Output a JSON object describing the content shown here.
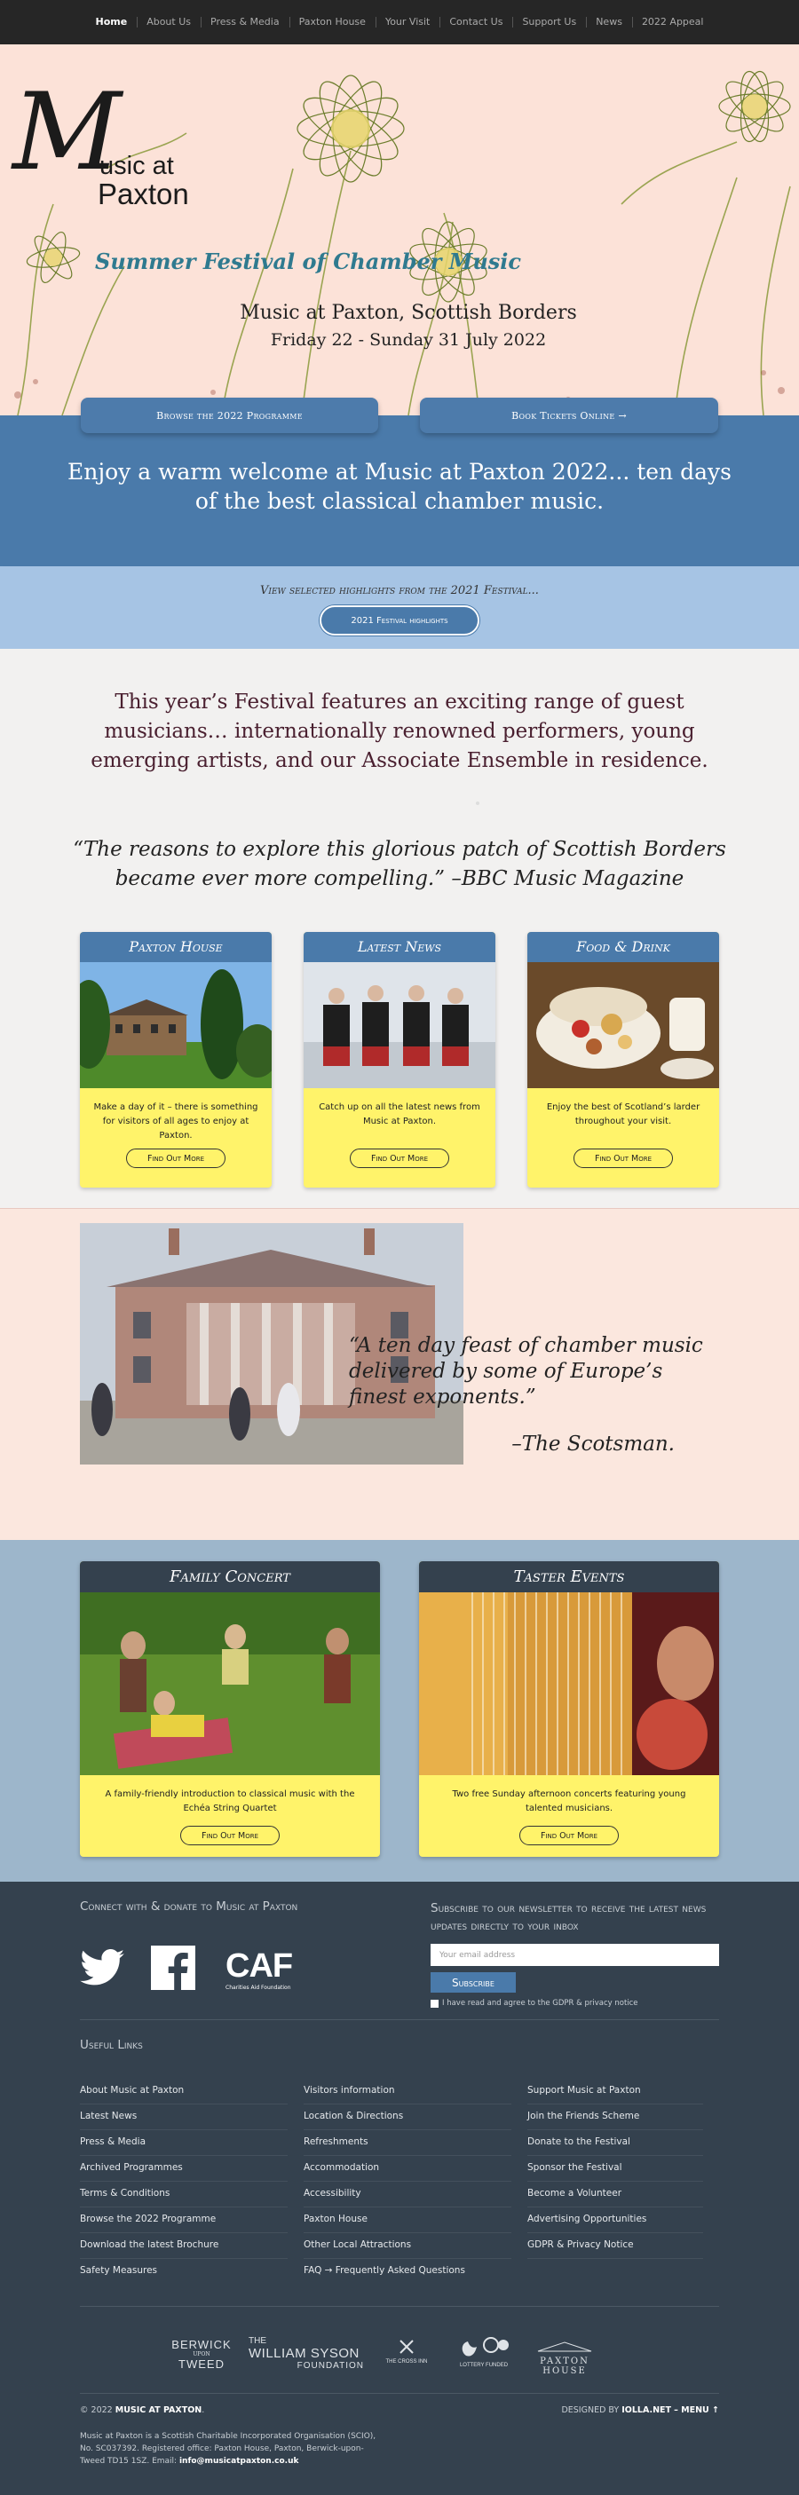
{
  "nav": {
    "items": [
      "Home",
      "About Us",
      "Press & Media",
      "Paxton House",
      "Your Visit",
      "Contact Us",
      "Support Us",
      "News",
      "2022 Appeal"
    ]
  },
  "hero": {
    "logo_m": "M",
    "logo_line1": "usic at",
    "logo_line2": "Paxton",
    "subtitle": "Summer Festival of Chamber Music",
    "line1": "Music at Paxton, Scottish Borders",
    "line2": "Friday 22 - Sunday 31 July 2022",
    "btn_programme": "Browse the 2022 Programme",
    "btn_tickets": "Book Tickets Online →"
  },
  "welcome": {
    "text": "Enjoy a warm welcome at Music at Paxton 2022... ten days of the best classical chamber music."
  },
  "highlights": {
    "text": "View selected highlights from the 2021 Festival...",
    "button": "2021 Festival highlights"
  },
  "intro": {
    "text": "This year’s Festival features an exciting range of guest musicians… internationally renowned performers, young emerging artists, and our Associate Ensemble in residence.",
    "quote": "“The reasons to explore this glorious patch of Scottish Borders became ever more compelling.” –BBC Music Magazine"
  },
  "cards": [
    {
      "title": "Paxton House",
      "text": "Make a day of it – there is something for visitors of all ages to enjoy at Paxton.",
      "button": "Find Out More"
    },
    {
      "title": "Latest News",
      "text": "Catch up on all the latest news from Music at Paxton.",
      "button": "Find Out More"
    },
    {
      "title": "Food & Drink",
      "text": "Enjoy the best of Scotland’s larder throughout your visit.",
      "button": "Find Out More"
    }
  ],
  "scotsman": {
    "quote": "“A ten day feast of chamber music delivered by some of Europe’s finest exponents.”",
    "attribution": "–The Scotsman."
  },
  "events": [
    {
      "title": "Family Concert",
      "text": "A family-friendly introduction to classical music with the Echéa String Quartet",
      "button": "Find Out More"
    },
    {
      "title": "Taster Events",
      "text": "Two free Sunday afternoon concerts featuring young talented musicians.",
      "button": "Find Out More"
    }
  ],
  "footer": {
    "connect_heading": "Connect with & donate to Music at Paxton",
    "caf_label": "CAF",
    "caf_sub": "Charities Aid Foundation",
    "newsletter_heading": "Subscribe to our newsletter to receive the latest news updates directly to your inbox",
    "email_placeholder": "Your email address",
    "subscribe": "Subscribe",
    "gdpr": "I have read and agree to the GDPR & privacy notice",
    "useful_heading": "Useful Links",
    "links_col1": [
      "About Music at Paxton",
      "Latest News",
      "Press & Media",
      "Archived Programmes",
      "Terms & Conditions",
      "Browse the 2022 Programme",
      "Download the latest Brochure",
      "Safety Measures"
    ],
    "links_col2": [
      "Visitors information",
      "Location & Directions",
      "Refreshments",
      "Accommodation",
      "Accessibility",
      "Paxton House",
      "Other Local Attractions",
      "FAQ → Frequently Asked Questions"
    ],
    "links_col3": [
      "Support Music at Paxton",
      "Join the Friends Scheme",
      "Donate to the Festival",
      "Sponsor the Festival",
      "Become a Volunteer",
      "Advertising Opportunities",
      "GDPR & Privacy Notice"
    ],
    "sponsors": {
      "berwick_1": "BERWICK",
      "berwick_2": "UPON",
      "berwick_3": "TWEED",
      "syson_1": "THE",
      "syson_2": "WILLIAM SYSON",
      "syson_3": "FOUNDATION",
      "cross_inn": "THE CROSS INN",
      "lottery": "LOTTERY FUNDED",
      "paxton": "PAXTON HOUSE"
    },
    "copyright_prefix": "© 2022",
    "copyright_name": "MUSIC AT PAXTON",
    "designed_prefix": "DESIGNED BY",
    "designed_name": "IOLLA.NET",
    "menu": "– MENU ↑",
    "charity_text": "Music at Paxton is a Scottish Charitable Incorporated Organisation (SCIO), No. SC037392. Registered office: Paxton House, Paxton, Berwick-upon-Tweed TD15 1SZ. Email:",
    "charity_email": "info@musicatpaxton.co.uk"
  }
}
